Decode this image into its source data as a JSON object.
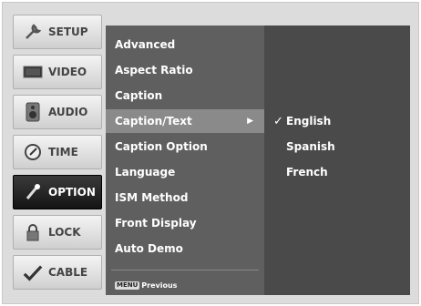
{
  "tabs": [
    {
      "label": "SETUP",
      "icon": "wrench-icon",
      "active": false
    },
    {
      "label": "VIDEO",
      "icon": "monitor-icon",
      "active": false
    },
    {
      "label": "AUDIO",
      "icon": "speaker-icon",
      "active": false
    },
    {
      "label": "TIME",
      "icon": "clock-icon",
      "active": false
    },
    {
      "label": "OPTION",
      "icon": "option-icon",
      "active": true
    },
    {
      "label": "LOCK",
      "icon": "padlock-icon",
      "active": false
    },
    {
      "label": "CABLE",
      "icon": "cable-icon",
      "active": false
    }
  ],
  "menu": {
    "items": [
      {
        "label": "Advanced"
      },
      {
        "label": "Aspect Ratio"
      },
      {
        "label": "Caption"
      },
      {
        "label": "Caption/Text",
        "selected": true,
        "arrow": "▶"
      },
      {
        "label": "Caption Option"
      },
      {
        "label": "Language"
      },
      {
        "label": "ISM Method"
      },
      {
        "label": "Front Display"
      },
      {
        "label": "Auto Demo"
      }
    ],
    "footer": {
      "key": "MENU",
      "label": "Previous"
    }
  },
  "submenu": {
    "options": [
      {
        "label": "English",
        "check": "✓"
      },
      {
        "label": "Spanish",
        "check": ""
      },
      {
        "label": "French",
        "check": ""
      }
    ]
  },
  "colors": {
    "menu_bg": "#5f5f5f",
    "submenu_bg": "#4a4a4a",
    "selected_bg": "#8a8a8a",
    "active_tab": "#141414"
  }
}
